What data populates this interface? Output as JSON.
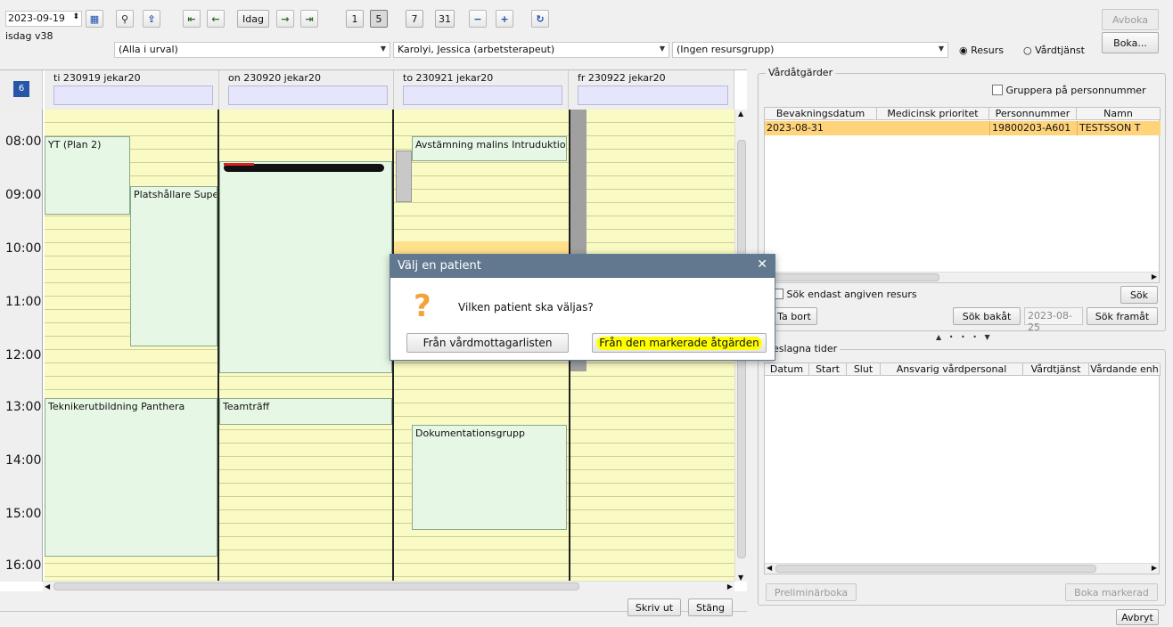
{
  "toolbar": {
    "date_value": "2023-09-19",
    "week_label": "isdag v38",
    "today_label": "Idag",
    "view_1": "1",
    "view_5": "5",
    "view_7": "7",
    "view_31": "31",
    "avboka": "Avboka",
    "boka": "Boka..."
  },
  "filters": {
    "selection": "(Alla i urval)",
    "resource": "Karolyi, Jessica (arbetsterapeut)",
    "resource_group": "(Ingen resursgrupp)",
    "radio_resurs": "Resurs",
    "radio_vardtjanst": "Vårdtjänst"
  },
  "calendar": {
    "days": [
      {
        "label": "ti 230919 jekar20"
      },
      {
        "label": "on 230920 jekar20"
      },
      {
        "label": "to 230921 jekar20"
      },
      {
        "label": "fr 230922 jekar20"
      }
    ],
    "hours": [
      "08:00",
      "09:00",
      "10:00",
      "11:00",
      "12:00",
      "13:00",
      "14:00",
      "15:00",
      "16:00"
    ],
    "appointments": {
      "yt": "YT (Plan 2)",
      "platshallare": "Platshållare Supe",
      "avstamning": "Avstämning malins Intruduktion",
      "teknikerutbildning": "Teknikerutbildning Panthera",
      "teamtraff": "Teamträff",
      "dokumentation": "Dokumentationsgrupp"
    }
  },
  "bottom": {
    "skriv_ut": "Skriv ut",
    "stang": "Stäng"
  },
  "vardatgarder": {
    "title": "Vårdåtgärder",
    "group_by_label": "Gruppera på personnummer",
    "columns": [
      "Bevakningsdatum",
      "Medicinsk prioritet",
      "Personnummer",
      "Namn"
    ],
    "rows": [
      {
        "date": "2023-08-31",
        "priority": "",
        "personnummer": "19800203-A601",
        "namn": "TESTSSON T"
      }
    ],
    "search_only_label": "Sök endast angiven resurs",
    "sok": "Sök",
    "ta_bort": "Ta bort",
    "sok_bakat": "Sök bakåt",
    "search_date": "2023-08-25",
    "sok_framat": "Sök framåt"
  },
  "foreslagna": {
    "title": "öreslagna tider",
    "columns": [
      "Datum",
      "Start",
      "Slut",
      "Ansvarig vårdpersonal",
      "Vårdtjänst",
      "Vårdande enh"
    ],
    "preliminarboka": "Preliminärboka",
    "boka_markerad": "Boka markerad",
    "avbryt": "Avbryt"
  },
  "dialog": {
    "title": "Välj en patient",
    "question": "Vilken patient ska väljas?",
    "btn_list": "Från vårdmottagarlisten",
    "btn_marked": "Från den markerade åtgärden"
  },
  "colors": {
    "calendar_slot": "#fafac5",
    "appointment": "#e6f7e6",
    "selected_row": "#ffd37a",
    "dialog_title": "#61788f",
    "highlight": "#ffff00"
  }
}
